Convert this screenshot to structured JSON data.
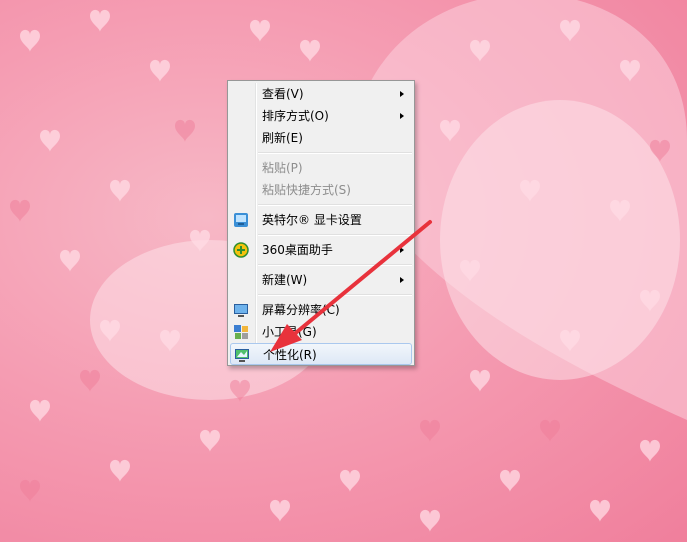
{
  "context_menu": {
    "items": [
      {
        "label": "查看(V)",
        "submenu": true
      },
      {
        "label": "排序方式(O)",
        "submenu": true
      },
      {
        "label": "刷新(E)"
      },
      {
        "label": "粘贴(P)",
        "disabled": true
      },
      {
        "label": "粘贴快捷方式(S)",
        "disabled": true
      },
      {
        "label": "英特尔® 显卡设置",
        "icon": "intel-graphics-icon"
      },
      {
        "label": "360桌面助手",
        "icon": "360-desktop-icon",
        "submenu": true
      },
      {
        "label": "新建(W)",
        "submenu": true
      },
      {
        "label": "屏幕分辨率(C)",
        "icon": "monitor-icon"
      },
      {
        "label": "小工具(G)",
        "icon": "gadgets-icon"
      },
      {
        "label": "个性化(R)",
        "icon": "personalize-icon",
        "highlighted": true
      }
    ]
  },
  "colors": {
    "wallpaper": "#f59cb2",
    "menu_bg": "#f0f0f0",
    "highlight_border": "#aac8ee",
    "annotation_arrow": "#e8323c"
  }
}
